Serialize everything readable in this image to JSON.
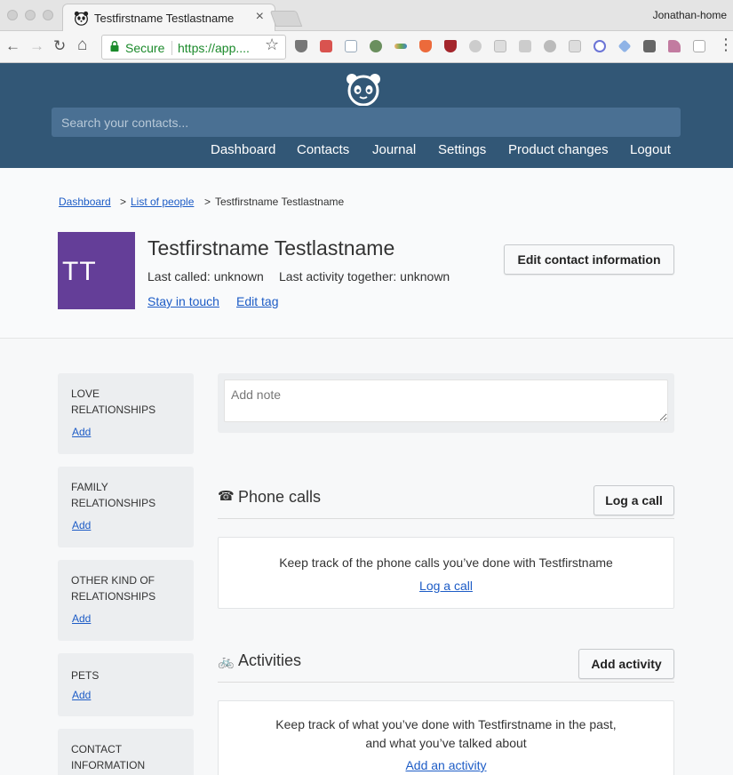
{
  "browser": {
    "tab_title": "Testfirstname Testlastname",
    "tab_close": "×",
    "profile_name": "Jonathan-home",
    "secure_label": "Secure",
    "url": "https://app....",
    "back_icon": "←",
    "forward_icon": "→",
    "reload_icon": "↻",
    "home_icon": "⌂",
    "star_icon": "☆"
  },
  "header": {
    "search_placeholder": "Search your contacts...",
    "nav": [
      "Dashboard",
      "Contacts",
      "Journal",
      "Settings",
      "Product changes",
      "Logout"
    ]
  },
  "breadcrumb": {
    "dashboard": "Dashboard",
    "list": "List of people",
    "sep": ">",
    "current": "Testfirstname Testlastname"
  },
  "contact": {
    "initials": "TT",
    "avatar_color": "#643e98",
    "name": "Testfirstname Testlastname",
    "last_called": "Last called: unknown",
    "last_activity": "Last activity together: unknown",
    "stay_in_touch": "Stay in touch",
    "edit_tag": "Edit tag",
    "edit_button": "Edit contact information"
  },
  "sidebar": [
    {
      "title": "Love relationships",
      "add": "Add"
    },
    {
      "title": "Family relationships",
      "add": "Add"
    },
    {
      "title": "Other kind of relationships",
      "add": "Add"
    },
    {
      "title": "Pets",
      "add": "Add"
    },
    {
      "title": "Contact information",
      "add": ""
    }
  ],
  "notes": {
    "placeholder": "Add note"
  },
  "phone_calls": {
    "icon": "☎",
    "title": "Phone calls",
    "button": "Log a call",
    "empty_text": "Keep track of the phone calls you’ve done with Testfirstname",
    "link": "Log a call"
  },
  "activities": {
    "icon": "🚲",
    "title": "Activities",
    "button": "Add activity",
    "empty_text": "Keep track of what you’ve done with Testfirstname in the past, and what you’ve talked about",
    "link": "Add an activity"
  },
  "colors": {
    "header_bg": "#325776",
    "search_bg": "#4a7093",
    "link": "#1d5cc6",
    "secure_green": "#1b8a2b"
  }
}
